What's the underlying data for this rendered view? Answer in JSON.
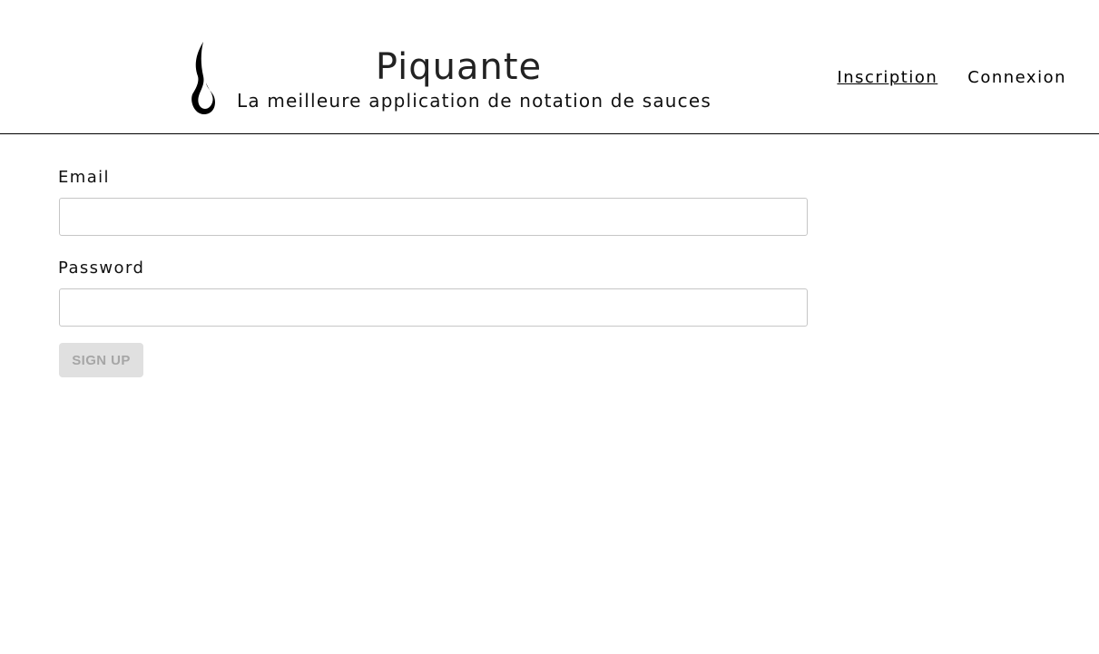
{
  "header": {
    "logo_icon": "flame-icon",
    "title": "Piquante",
    "tagline": "La meilleure application de notation de sauces"
  },
  "nav": {
    "items": [
      {
        "label": "Inscription",
        "active": true
      },
      {
        "label": "Connexion",
        "active": false
      }
    ]
  },
  "form": {
    "email": {
      "label": "Email",
      "value": "",
      "placeholder": ""
    },
    "password": {
      "label": "Password",
      "value": "",
      "placeholder": ""
    },
    "submit_label": "Sign up",
    "submit_disabled": true
  },
  "colors": {
    "text": "#1a1a1a",
    "divider": "#000000",
    "input_border": "#c6c6c6",
    "button_bg_disabled": "#e0e0e0",
    "button_text_disabled": "#a6a6a6"
  }
}
